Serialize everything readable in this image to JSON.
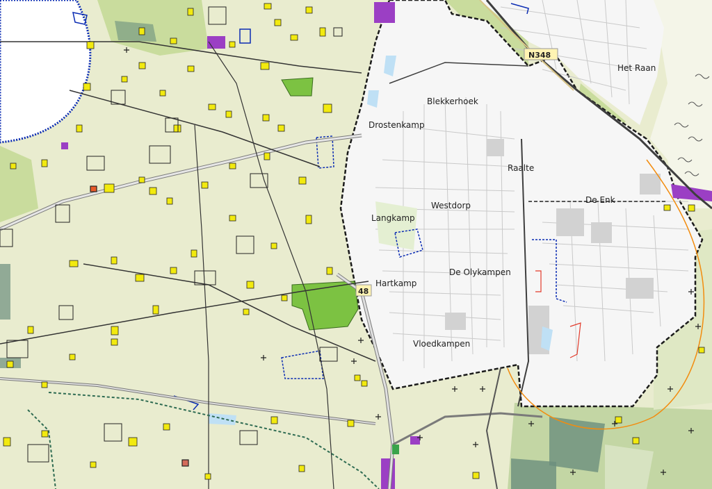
{
  "map": {
    "place_labels": [
      {
        "key": "het-raan",
        "text": "Het Raan"
      },
      {
        "key": "blekkerhoek",
        "text": "Blekkerhoek"
      },
      {
        "key": "drostenkamp",
        "text": "Drostenkamp"
      },
      {
        "key": "raalte",
        "text": "Raalte"
      },
      {
        "key": "de-enk",
        "text": "De Enk"
      },
      {
        "key": "westdorp",
        "text": "Westdorp"
      },
      {
        "key": "langkamp",
        "text": "Langkamp"
      },
      {
        "key": "de-olykampen",
        "text": "De Olykampen"
      },
      {
        "key": "hartkamp",
        "text": "Hartkamp"
      },
      {
        "key": "vloedkampen",
        "text": "Vloedkampen"
      }
    ],
    "road_shields": [
      {
        "key": "n348-north",
        "text": "N348"
      },
      {
        "key": "n348-west",
        "text": "48"
      }
    ],
    "colors": {
      "rural_land": "#e9eccf",
      "urban_area": "#f6f6f6",
      "water": "#ffffff",
      "buildings_rural": "#f2ea0f",
      "parks": "#7cc242",
      "forest": "#6b8f7d",
      "industry": "#9b3fc4",
      "boundary": "#1b1b1b",
      "water_outline": "#0a2bb3"
    }
  }
}
